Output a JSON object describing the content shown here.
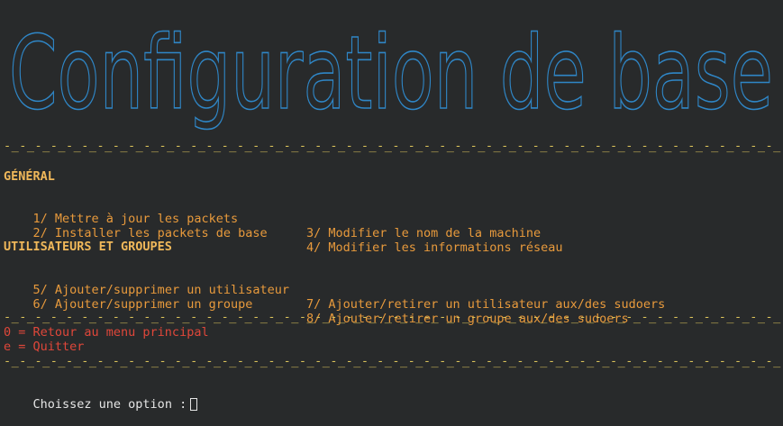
{
  "banner": {
    "title": "Configuration de base",
    "color": "#2f86c6"
  },
  "separator": "-_-_-_-_-_-_-_-_-_-_-_-_-_-_-_-_-_-_-_-_-_-_-_-_-_-_-_-_-_-_-_-_-_-_-_-_-_-_-_-_-_-_-_-_-_-_-_-_-_-_-",
  "sections": {
    "general": {
      "heading": "GÉNÉRAL",
      "options": [
        "1/ Mettre à jour les packets",
        "2/ Installer les packets de base",
        "3/ Modifier le nom de la machine",
        "4/ Modifier les informations réseau"
      ]
    },
    "users": {
      "heading": "UTILISATEURS ET GROUPES",
      "options": [
        "5/ Ajouter/supprimer un utilisateur",
        "6/ Ajouter/supprimer un groupe",
        "7/ Ajouter/retirer un utilisateur aux/des sudoers",
        "8/ Ajouter/retirer un groupe aux/des sudoers"
      ]
    }
  },
  "footer": {
    "back": "0 = Retour au menu principal",
    "quit": "e = Quitter"
  },
  "prompt": {
    "label": "Choissez une option :"
  },
  "colors": {
    "background": "#282a2b",
    "separator": "#d9c15a",
    "heading": "#f0b85a",
    "option": "#e89a3c",
    "danger": "#e0473a"
  }
}
